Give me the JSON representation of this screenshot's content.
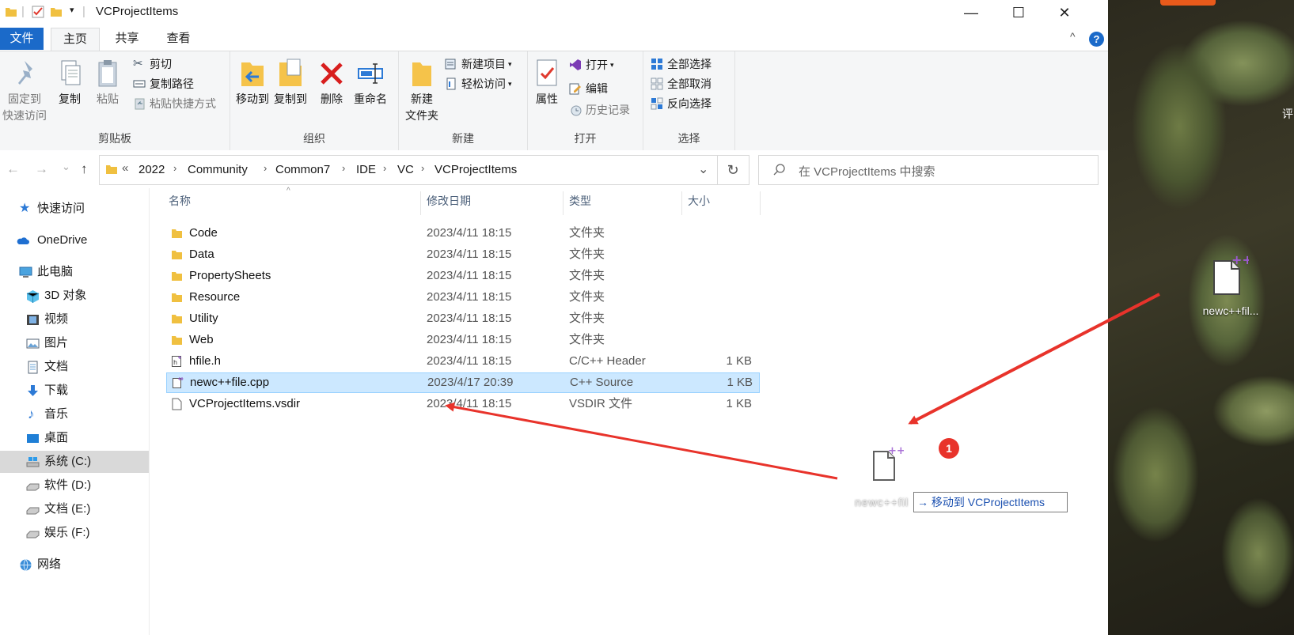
{
  "window": {
    "title": "VCProjectItems",
    "minimize": "—",
    "maximize": "☐",
    "close": "✕"
  },
  "ribbon": {
    "tabs": {
      "file": "文件",
      "home": "主页",
      "share": "共享",
      "view": "查看"
    },
    "help": "?",
    "collapse": "^",
    "clipboard": {
      "label": "剪贴板",
      "pin_line1": "固定到",
      "pin_line2": "快速访问",
      "copy": "复制",
      "paste": "粘贴",
      "cut": "剪切",
      "copy_path": "复制路径",
      "paste_shortcut": "粘贴快捷方式"
    },
    "organize": {
      "label": "组织",
      "move_to": "移动到",
      "copy_to": "复制到",
      "delete": "删除",
      "rename": "重命名"
    },
    "new": {
      "label": "新建",
      "new_folder_line1": "新建",
      "new_folder_line2": "文件夹",
      "new_item": "新建项目",
      "easy_access": "轻松访问"
    },
    "open": {
      "label": "打开",
      "properties": "属性",
      "open": "打开",
      "edit": "编辑",
      "history": "历史记录"
    },
    "select": {
      "label": "选择",
      "select_all": "全部选择",
      "select_none": "全部取消",
      "invert": "反向选择"
    }
  },
  "navigation": {
    "back": "←",
    "forward": "→",
    "recent": "⌄",
    "up": "↑",
    "breadcrumb_overflow": "«",
    "breadcrumbs": [
      "2022",
      "Community",
      "Common7",
      "IDE",
      "VC",
      "VCProjectItems"
    ],
    "search_placeholder": "在 VCProjectItems 中搜索"
  },
  "nav_pane": [
    {
      "label": "快速访问",
      "icon": "star-icon"
    },
    {
      "label": "OneDrive",
      "icon": "cloud-icon"
    },
    {
      "label": "此电脑",
      "icon": "computer-icon"
    },
    {
      "label": "3D 对象",
      "icon": "cube-icon"
    },
    {
      "label": "视频",
      "icon": "video-icon"
    },
    {
      "label": "图片",
      "icon": "picture-icon"
    },
    {
      "label": "文档",
      "icon": "document-icon"
    },
    {
      "label": "下载",
      "icon": "download-icon"
    },
    {
      "label": "音乐",
      "icon": "music-icon"
    },
    {
      "label": "桌面",
      "icon": "desktop-icon"
    },
    {
      "label": "系统 (C:)",
      "icon": "drive-icon",
      "selected": true
    },
    {
      "label": "软件 (D:)",
      "icon": "drive-icon"
    },
    {
      "label": "文档 (E:)",
      "icon": "drive-icon"
    },
    {
      "label": "娱乐 (F:)",
      "icon": "drive-icon"
    },
    {
      "label": "网络",
      "icon": "network-icon"
    }
  ],
  "columns": {
    "name": "名称",
    "date": "修改日期",
    "type": "类型",
    "size": "大小"
  },
  "files": [
    {
      "name": "Code",
      "date": "2023/4/11 18:15",
      "type": "文件夹",
      "size": "",
      "icon": "folder-icon"
    },
    {
      "name": "Data",
      "date": "2023/4/11 18:15",
      "type": "文件夹",
      "size": "",
      "icon": "folder-icon"
    },
    {
      "name": "PropertySheets",
      "date": "2023/4/11 18:15",
      "type": "文件夹",
      "size": "",
      "icon": "folder-icon"
    },
    {
      "name": "Resource",
      "date": "2023/4/11 18:15",
      "type": "文件夹",
      "size": "",
      "icon": "folder-icon"
    },
    {
      "name": "Utility",
      "date": "2023/4/11 18:15",
      "type": "文件夹",
      "size": "",
      "icon": "folder-icon"
    },
    {
      "name": "Web",
      "date": "2023/4/11 18:15",
      "type": "文件夹",
      "size": "",
      "icon": "folder-icon"
    },
    {
      "name": "hfile.h",
      "date": "2023/4/11 18:15",
      "type": "C/C++ Header",
      "size": "1 KB",
      "icon": "header-file-icon"
    },
    {
      "name": "newc++file.cpp",
      "date": "2023/4/17 20:39",
      "type": "C++ Source",
      "size": "1 KB",
      "icon": "cpp-file-icon",
      "selected": true
    },
    {
      "name": "VCProjectItems.vsdir",
      "date": "2023/4/11 18:15",
      "type": "VSDIR 文件",
      "size": "1 KB",
      "icon": "blank-file-icon"
    }
  ],
  "drag": {
    "name": "newc++fil",
    "tooltip": "→ 移动到 VCProjectItems",
    "badge": "1"
  },
  "desktop": {
    "icon_label": "newc++fil...",
    "edge_text": "评"
  },
  "colors": {
    "accent": "#1b6ac9",
    "selection": "#cce8ff",
    "annotation_arrow": "#e8332b"
  }
}
